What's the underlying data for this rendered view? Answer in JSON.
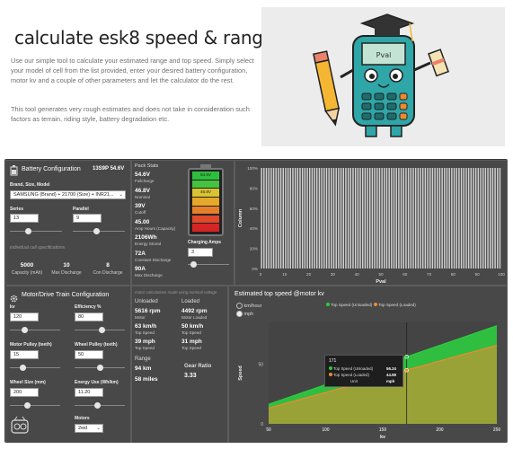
{
  "hero": {
    "title": "calculate esk8 speed & range",
    "p1": "Use our simple tool to calculate your estimated range and top speed. Simply select your model of cell from the list provided, enter your desired battery configuration, motor kv and a couple of other parameters and let the calculator do the rest.",
    "p2": "This tool generates very rough estimates and does not take in consideration such factors as terrain, riding style, battery degradation etc.",
    "calc_screen": "Pval"
  },
  "battery": {
    "title": "Battery Configuration",
    "summary": "13S9P 54.6V",
    "brand_label": "Brand, Size, Model",
    "brand_value": "SAMSUNG (Brand) + 21700 (Size) + INR21...",
    "series_label": "Series",
    "series_value": "13",
    "series_level": 0.35,
    "parallel_label": "Parallel",
    "parallel_value": "9",
    "parallel_level": 0.45,
    "specs_heading": "individual cell specifications",
    "specs": [
      {
        "value": "5000",
        "label": "Capacity (mAh)"
      },
      {
        "value": "10",
        "label": "Max Discharge"
      },
      {
        "value": "8",
        "label": "Con Discharge"
      }
    ]
  },
  "pack": {
    "title": "Pack Stats",
    "stats": [
      {
        "value": "54.6V",
        "label": "Fullcharge"
      },
      {
        "value": "46.8V",
        "label": "Nominal"
      },
      {
        "value": "39V",
        "label": "Cutoff"
      },
      {
        "value": "45.00",
        "label": "Amp Hours (Capacity)"
      },
      {
        "value": "2106Wh",
        "label": "Energy Stored"
      },
      {
        "value": "72A",
        "label": "Constant Discharge"
      },
      {
        "value": "90A",
        "label": "Max Discharge"
      }
    ],
    "battery_levels": [
      "54.6V",
      "",
      "46.8V",
      "",
      "",
      "",
      ""
    ],
    "charging_label": "Charging Amps",
    "charging_value": "3",
    "charging_level": 0.15
  },
  "column_chart": {
    "ylabel": "Column",
    "xlabel": "Pval",
    "yticks": [
      "100%",
      "80%",
      "60%",
      "40%",
      "20%",
      "0%"
    ],
    "xticks": [
      "0",
      "10",
      "20",
      "30",
      "40",
      "50",
      "60",
      "70",
      "80",
      "90",
      "100"
    ],
    "bar_count": 100
  },
  "motor": {
    "title": "Motor/Drive Train Configuration",
    "fields": [
      {
        "label": "kv",
        "value": "120",
        "level": 0.3
      },
      {
        "label": "Efficiency %",
        "value": "80",
        "level": 0.55
      },
      {
        "label": "Motor Pulley (teeth)",
        "value": "15",
        "level": 0.25
      },
      {
        "label": "Wheel Pulley (teeth)",
        "value": "50",
        "level": 0.5
      },
      {
        "label": "Wheel Size (mm)",
        "value": "200",
        "level": 0.35
      },
      {
        "label": "Energy Use (Wh/km)",
        "value": "11.20",
        "level": 0.45
      }
    ],
    "motors_label": "Motors",
    "motors_value": "2wd"
  },
  "results": {
    "note": "motor calculations made using nominal voltage",
    "unloaded_title": "Unloaded",
    "loaded_title": "Loaded",
    "unloaded": [
      {
        "value": "5616 rpm",
        "label": "Motor"
      },
      {
        "value": "63 km/h",
        "label": "Top Speed"
      },
      {
        "value": "39 mph",
        "label": "Top Speed"
      }
    ],
    "loaded": [
      {
        "value": "4492 rpm",
        "label": "Motor Loaded"
      },
      {
        "value": "50 km/h",
        "label": "Top Speed"
      },
      {
        "value": "31 mph",
        "label": "Top Speed"
      }
    ],
    "range_title": "Range",
    "range_km": "94 km",
    "range_miles": "58 miles",
    "gear_label": "Gear Ratio",
    "gear_value": "3.33"
  },
  "speed_chart": {
    "title": "Estimated top speed @motor kv",
    "unit_options": [
      "km/hour",
      "mph"
    ],
    "selected_unit": "mph",
    "legend": [
      "Top Speed (Unloaded)",
      "Top Speed (Loaded)"
    ],
    "colors": {
      "unloaded": "#2ecc40",
      "loaded": "#f08a30"
    },
    "ylabel": "Speed",
    "xlabel": "kv",
    "yticks": [
      "0",
      "50"
    ],
    "xticks": [
      "50",
      "100",
      "150",
      "200",
      "250"
    ],
    "tooltip": {
      "header": "171",
      "rows": [
        {
          "label": "Top Speed (Unloaded)",
          "value": "56.24"
        },
        {
          "label": "Top Speed (Loaded)",
          "value": "44.99"
        },
        {
          "label": "Unit",
          "value": "mph"
        }
      ]
    }
  },
  "chart_data": {
    "type": "area",
    "title": "Estimated top speed @motor kv",
    "xlabel": "kv",
    "ylabel": "Speed",
    "x": [
      50,
      250
    ],
    "xlim": [
      50,
      250
    ],
    "ylim": [
      0,
      85
    ],
    "series": [
      {
        "name": "Top Speed (Unloaded)",
        "values": [
          16.4,
          82.2
        ]
      },
      {
        "name": "Top Speed (Loaded)",
        "values": [
          13.2,
          65.8
        ]
      }
    ]
  }
}
